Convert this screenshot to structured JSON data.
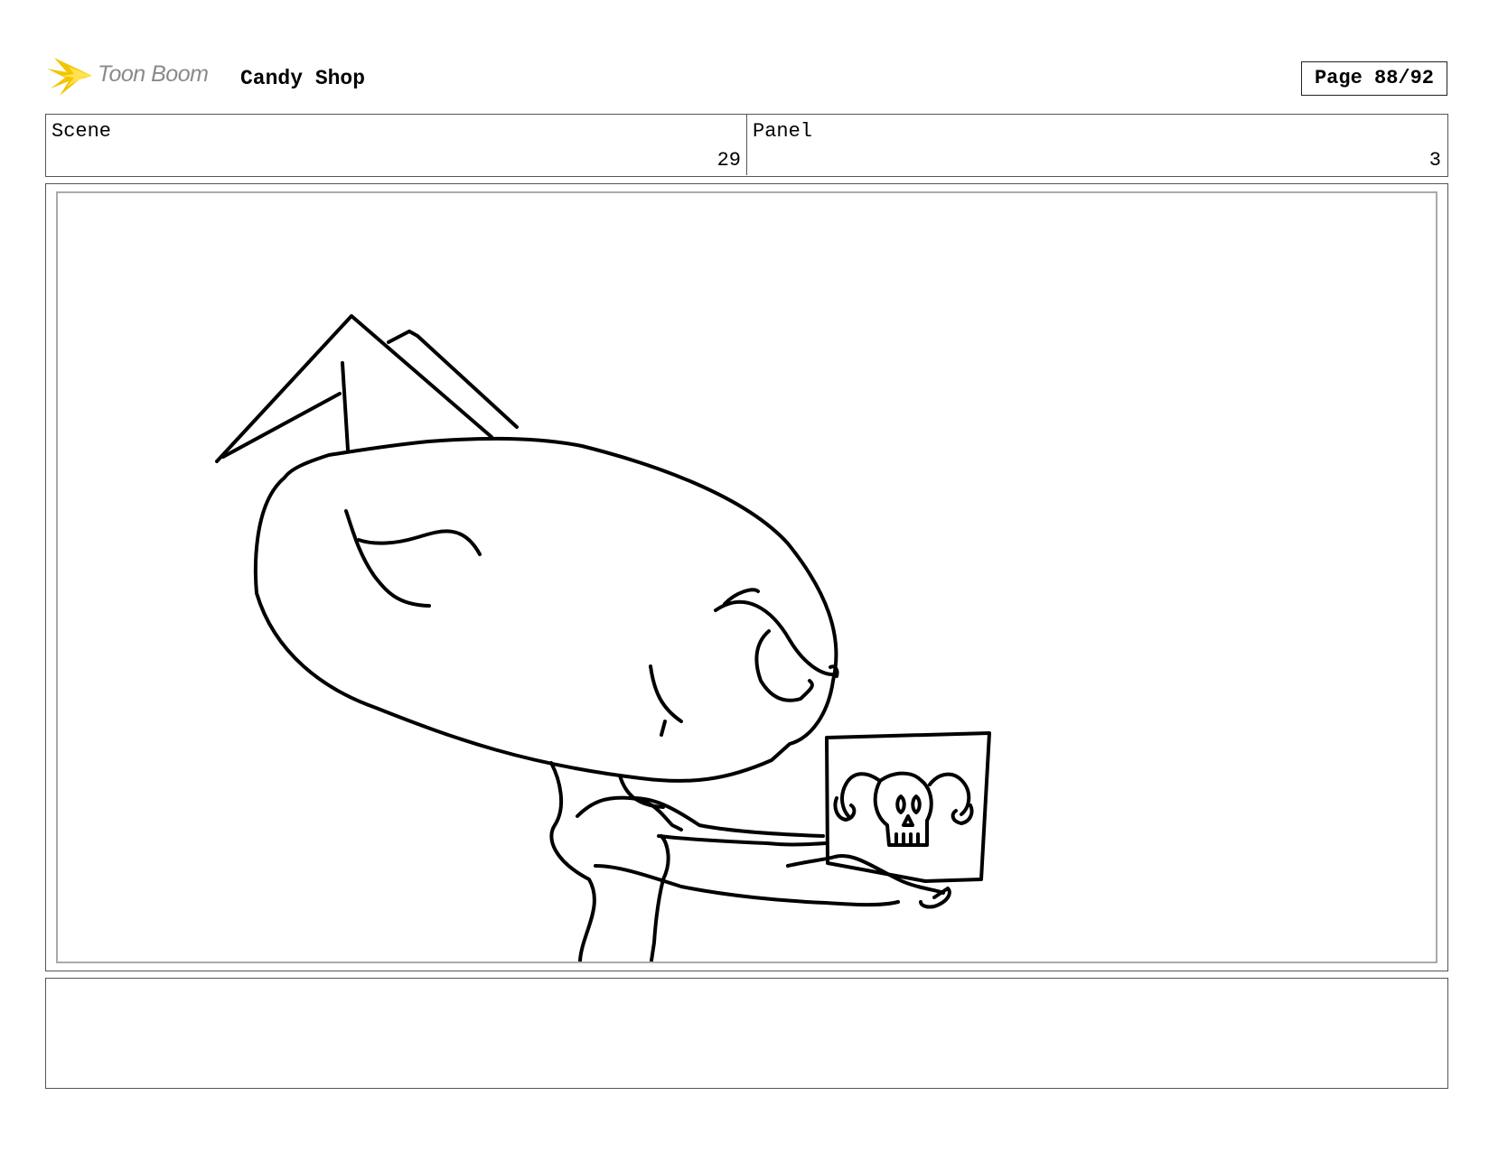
{
  "header": {
    "logo_text": "Toon Boom",
    "project_title": "Candy Shop",
    "page_label": "Page 88/92"
  },
  "info": {
    "scene_label": "Scene",
    "scene_value": "29",
    "panel_label": "Panel",
    "panel_value": "3"
  },
  "panel": {
    "drawing_icon": "storyboard-sketch-character-holding-skull-sign"
  },
  "notes": {
    "text": ""
  }
}
